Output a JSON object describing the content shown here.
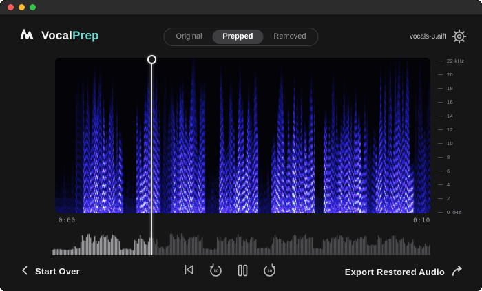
{
  "window": {
    "traffic_lights": [
      {
        "name": "close",
        "color": "#f7605a"
      },
      {
        "name": "minimize",
        "color": "#fbbd2e"
      },
      {
        "name": "zoom",
        "color": "#34c648"
      }
    ]
  },
  "header": {
    "logo": {
      "text_primary": "Vocal",
      "text_accent": "Prep",
      "accent_color": "#6fd9d2"
    },
    "tabs": [
      {
        "label": "Original",
        "selected": false
      },
      {
        "label": "Prepped",
        "selected": true
      },
      {
        "label": "Removed",
        "selected": false
      }
    ],
    "filename": "vocals-3.aiff"
  },
  "spectrogram": {
    "freq_labels": [
      "22 kHz",
      "20",
      "18",
      "16",
      "14",
      "12",
      "10",
      "8",
      "6",
      "4",
      "2",
      "0 kHz"
    ],
    "time_start": "0:00",
    "time_end": "0:10",
    "playhead_fraction": 0.257,
    "seed": 7,
    "segments": [
      {
        "a": 0.0,
        "b": 0.055,
        "v": 0.14
      },
      {
        "a": 0.055,
        "b": 0.075,
        "v": 0.32
      },
      {
        "a": 0.075,
        "b": 0.18,
        "v": 0.92
      },
      {
        "a": 0.18,
        "b": 0.215,
        "v": 0.18
      },
      {
        "a": 0.215,
        "b": 0.28,
        "v": 0.85
      },
      {
        "a": 0.28,
        "b": 0.31,
        "v": 0.34
      },
      {
        "a": 0.31,
        "b": 0.4,
        "v": 0.9
      },
      {
        "a": 0.4,
        "b": 0.435,
        "v": 0.2
      },
      {
        "a": 0.435,
        "b": 0.54,
        "v": 0.87
      },
      {
        "a": 0.54,
        "b": 0.575,
        "v": 0.24
      },
      {
        "a": 0.575,
        "b": 0.69,
        "v": 0.95
      },
      {
        "a": 0.69,
        "b": 0.715,
        "v": 0.2
      },
      {
        "a": 0.715,
        "b": 0.83,
        "v": 0.9
      },
      {
        "a": 0.83,
        "b": 0.855,
        "v": 0.45
      },
      {
        "a": 0.855,
        "b": 0.955,
        "v": 0.85
      },
      {
        "a": 0.955,
        "b": 1.01,
        "v": 0.38
      }
    ],
    "colormap": [
      [
        0.0,
        "#030308"
      ],
      [
        0.14,
        "#0a0a34"
      ],
      [
        0.32,
        "#16169c"
      ],
      [
        0.5,
        "#2e2ae0"
      ],
      [
        0.66,
        "#5a3cf4"
      ],
      [
        0.78,
        "#8a55ff"
      ],
      [
        0.87,
        "#b46cff"
      ],
      [
        0.93,
        "#7adeff"
      ],
      [
        1.0,
        "#e8fffb"
      ]
    ]
  },
  "waveform": {
    "progress_fraction": 0.263,
    "played_color": "#b4b4b6",
    "unplayed_color": "#555558",
    "cursor_color": "#e2e2e4"
  },
  "footer": {
    "start_over_label": "Start Over",
    "export_label": "Export Restored Audio",
    "rewind_badge": "10",
    "forward_badge": "10"
  }
}
